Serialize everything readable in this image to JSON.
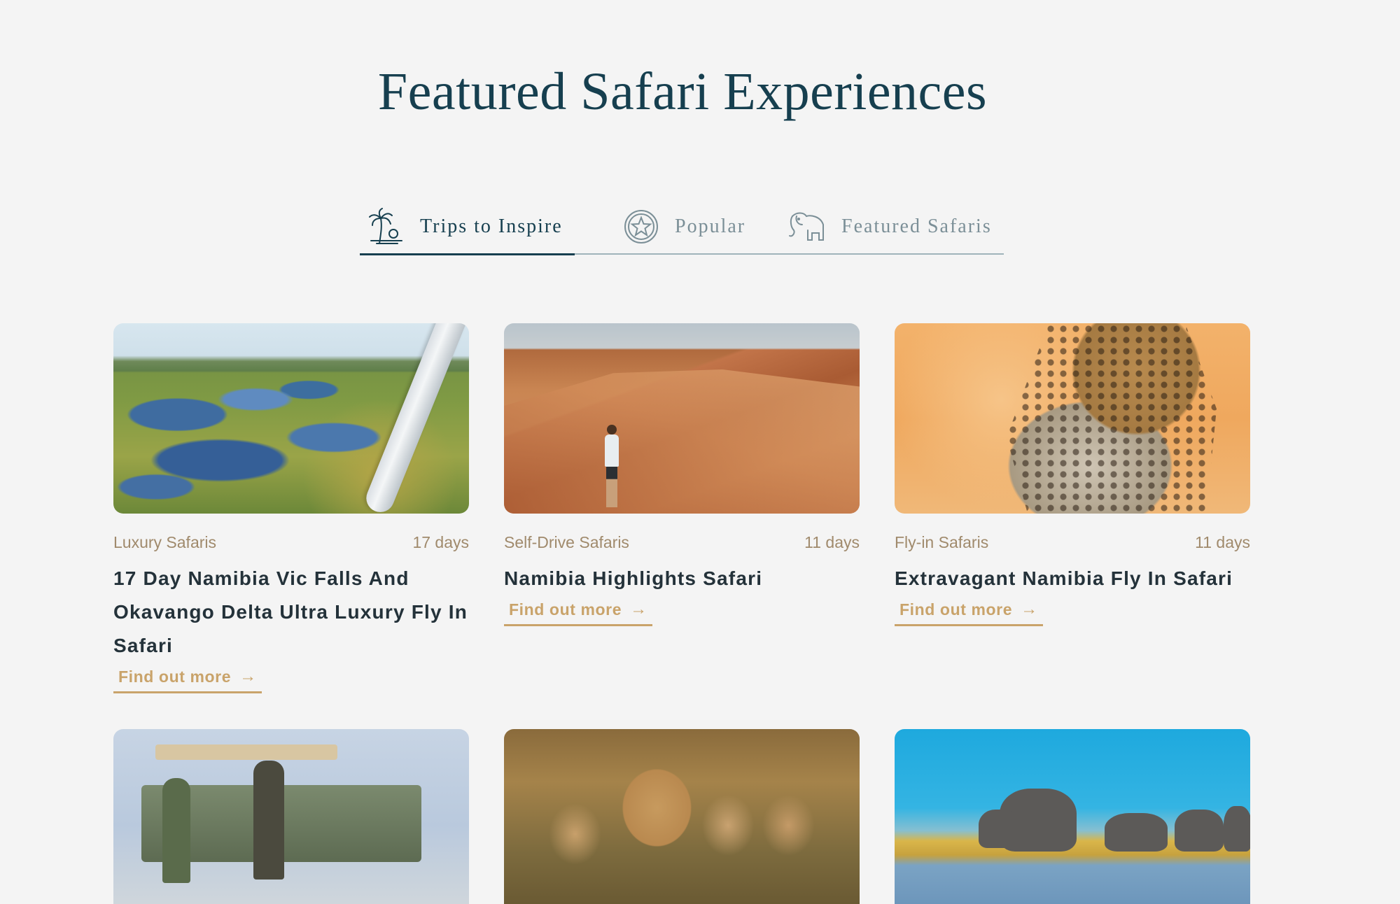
{
  "page": {
    "title": "Featured Safari Experiences"
  },
  "tabs": [
    {
      "label": "Trips to Inspire",
      "icon": "palm-tree-icon",
      "active": true
    },
    {
      "label": "Popular",
      "icon": "star-icon",
      "active": false
    },
    {
      "label": "Featured Safaris",
      "icon": "elephant-icon",
      "active": false
    }
  ],
  "cards": [
    {
      "category": "Luxury Safaris",
      "duration": "17 days",
      "title": "17 Day Namibia Vic Falls And Okavango Delta Ultra Luxury Fly In Safari",
      "cta": "Find out more",
      "image": "aerial-okavango-delta-photo"
    },
    {
      "category": "Self-Drive Safaris",
      "duration": "11 days",
      "title": "Namibia Highlights Safari",
      "cta": "Find out more",
      "image": "desert-dune-photo"
    },
    {
      "category": "Fly-in Safaris",
      "duration": "11 days",
      "title": "Extravagant Namibia Fly In Safari",
      "cta": "Find out more",
      "image": "leopard-photo"
    },
    {
      "image": "safari-jeep-photo"
    },
    {
      "image": "cheetah-cubs-photo"
    },
    {
      "image": "elephants-river-photo"
    }
  ],
  "colors": {
    "background": "#f4f4f4",
    "heading": "#163f4f",
    "tab_inactive": "#7b8f97",
    "meta_text": "#a08a6c",
    "cta_gold": "#c9a36a",
    "card_title": "#24323a"
  },
  "icons": {
    "cta_arrow": "arrow-right-icon"
  }
}
